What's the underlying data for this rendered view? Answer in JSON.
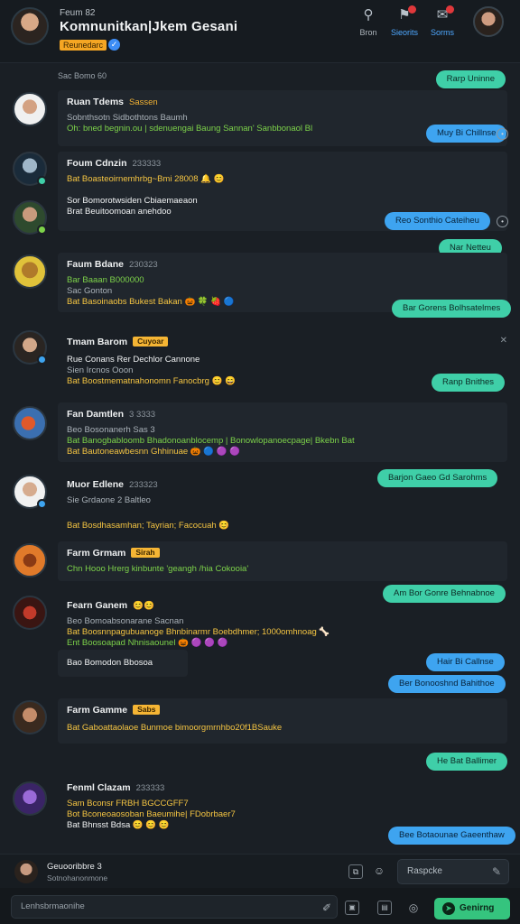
{
  "header": {
    "subtitle": "Feum 82",
    "title": "Komnunitkan|Jkem Gesani",
    "tag": "Reunedarc",
    "actions": [
      {
        "label": "Bron",
        "icon": "search-icon"
      },
      {
        "label": "Sieorits",
        "icon": "bell-icon"
      },
      {
        "label": "Sorms",
        "icon": "chat-icon"
      }
    ]
  },
  "feed": {
    "divider": "Sac Bomo 60",
    "items": [
      {
        "name": "Ruan Tdems",
        "meta": "Sassen",
        "lines": [
          {
            "text": "Sobnthsotn   Sidbothtons Baumh",
            "style": "dim"
          },
          {
            "text": "Oh: bned begnin.ou | sdenuengai Baung  Sannan' Sanbbonaol Bl",
            "style": "green"
          }
        ],
        "replies": [
          {
            "text": "Rarp Uninne",
            "color": "teal"
          },
          {
            "text": "Muy Bi Chillnse",
            "color": "blue"
          }
        ]
      },
      {
        "name": "Foum Cdnzin",
        "meta": "233333",
        "lines": [
          {
            "text": "Bat Boasteoirnemhrbg~Bmi 28008 🔔 😊",
            "style": "yellow"
          },
          {
            "text": "Sor Bomorotwsiden  Cbiaemaeaon",
            "style": "white"
          },
          {
            "text": "Brat  Beuitoomoan anehdoo",
            "style": "white"
          }
        ],
        "replies": [
          {
            "text": "Reo Sonthio Cateiheu",
            "color": "blue"
          },
          {
            "text": "Nar Netteu",
            "color": "teal"
          }
        ]
      },
      {
        "name": "Faum Bdane",
        "meta": "230323",
        "lines": [
          {
            "text": "Bar Baaan   B000000",
            "style": "green"
          },
          {
            "text": "Sac Gonton",
            "style": "dim"
          },
          {
            "text": "Bat Basoinaobs Bukest Bakan 🎃 🍀 🍓 🔵",
            "style": "yellow"
          }
        ],
        "replies": [
          {
            "text": "Bar Gorens Bolhsatelmes",
            "color": "teal"
          }
        ]
      },
      {
        "name": "Tmam Barom",
        "meta": "Cuyoar",
        "lines": [
          {
            "text": "Rue Conans  Rer Dechlor Cannone",
            "style": "white"
          },
          {
            "text": "Sien Ircnos   Ooon",
            "style": "dim"
          },
          {
            "text": "Bat Boostmematnahonomn Fanocbrg 😊 😄",
            "style": "yellow"
          }
        ],
        "replies": [
          {
            "text": "Ranp Bnithes",
            "color": "teal"
          }
        ]
      },
      {
        "name": "Fan Damtlen",
        "meta": "3 3333",
        "lines": [
          {
            "text": "Beo Bosonanerh Sas 3",
            "style": "dim"
          },
          {
            "text": "Bat Banogbabloomb  Bhadonoanblocemp | Bonowlopanoecpage| Bkebn Bat",
            "style": "green"
          },
          {
            "text": "Bat Bautoneawbesnn Ghhinuae 🎃 🔵 🟣 🟣",
            "style": "yellow"
          }
        ],
        "replies": [
          {
            "text": "Barjon Gaeo Gd Sarohms",
            "color": "teal"
          }
        ]
      },
      {
        "name": "Muor Edlene",
        "meta": "233323",
        "lines": [
          {
            "text": "Sie Grdaone 2 Baltleo",
            "style": "dim"
          },
          {
            "text": "",
            "style": "dim"
          },
          {
            "text": "Bat Bosdhasamhan;  Tayrian; Facocuah 😊",
            "style": "yellow"
          }
        ],
        "replies": []
      },
      {
        "name": "Farm Grmam",
        "meta": "Sirah",
        "lines": [
          {
            "text": "Chn  Hooo  Hrerg kinbunte  'geangh /hia Cokooia'",
            "style": "green"
          }
        ],
        "replies": [
          {
            "text": "Am Bor Gonre Behnabnoe",
            "color": "teal"
          }
        ]
      },
      {
        "name": "Fearn Ganem",
        "meta": "😊😊",
        "lines": [
          {
            "text": "Beo Bomoabsonarane Sacnan",
            "style": "dim"
          },
          {
            "text": "Bat Boosnnpagubuanoge  Bhnbinarmr  Boebdhmer; 1000omhnoag 🦴",
            "style": "yellow"
          },
          {
            "text": "Ent Boosoapad Nhnisaounel 🎃 🟣 🟣 🟣",
            "style": "green"
          }
        ],
        "replies": []
      },
      {
        "name": "",
        "meta": "",
        "lines": [
          {
            "text": "Bao Bomodon Bbosoa",
            "style": "white"
          }
        ],
        "replies": [
          {
            "text": "Hair Bi Callnse",
            "color": "blue"
          },
          {
            "text": "Ber Bonooshnd Bahithoe",
            "color": "blue"
          }
        ]
      },
      {
        "name": "Farm Gamme",
        "meta": "Sabs",
        "lines": [
          {
            "text": "Bat Gaboattaolaoe Bunmoe bimoorgmrnhbo20f1BSauke",
            "style": "yellow"
          }
        ],
        "replies": [
          {
            "text": "He Bat Ballimer",
            "color": "teal"
          }
        ]
      },
      {
        "name": "Fenml Clazam",
        "meta": "233333",
        "lines": [
          {
            "text": "Sam Bconsr  FRBH BGCCGFF7",
            "style": "yellow"
          },
          {
            "text": "Bot  Bconeoaosoban  Baeumihe| FDobrbaer7",
            "style": "yellow"
          },
          {
            "text": "Bat  Bhnsst Bdsa  😊 😊 😊",
            "style": "white"
          }
        ],
        "replies": [
          {
            "text": "Bee Botaounae Gaeenthaw",
            "color": "blue"
          }
        ]
      }
    ]
  },
  "now_playing": {
    "title": "Geuooribbre  3",
    "subtitle": "Sotnohanonmone",
    "reply_placeholder": "Raspcke"
  },
  "composer": {
    "placeholder": "Lenhsbrmaonihe",
    "send_label": "Genirng"
  },
  "colors": {
    "accent_teal": "#3fcfa8",
    "accent_blue": "#3ea4f0",
    "send_green": "#35c47e",
    "badge_red": "#e0383b"
  }
}
